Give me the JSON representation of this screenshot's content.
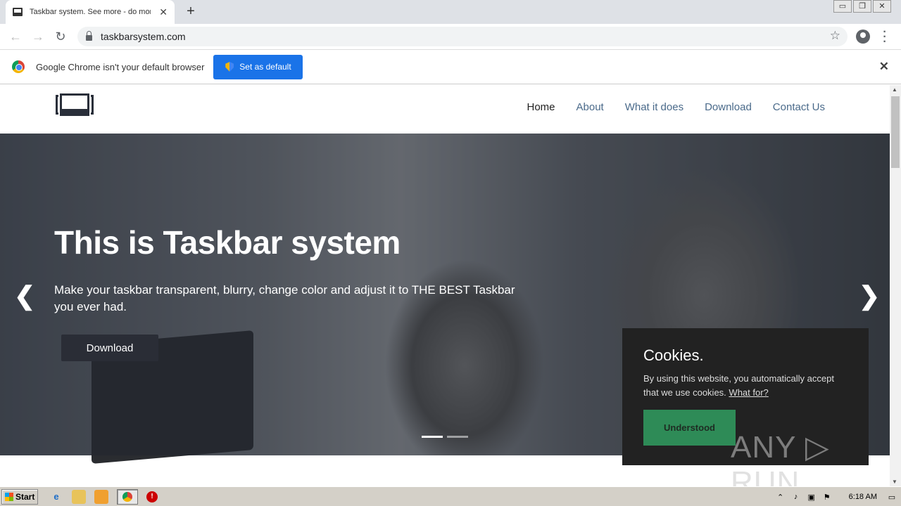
{
  "browser": {
    "tab_title": "Taskbar system. See more - do more",
    "tab_close": "✕",
    "new_tab": "+",
    "url": "taskbarsystem.com",
    "window_buttons": [
      "▭",
      "❐",
      "✕"
    ]
  },
  "infobar": {
    "message": "Google Chrome isn't your default browser",
    "button_label": "Set as default",
    "close": "✕"
  },
  "site": {
    "nav": [
      {
        "label": "Home",
        "active": true
      },
      {
        "label": "About"
      },
      {
        "label": "What it does"
      },
      {
        "label": "Download"
      },
      {
        "label": "Contact Us"
      }
    ],
    "hero": {
      "title": "This is Taskbar system",
      "subtitle": "Make your taskbar transparent, blurry, change color and adjust it to THE BEST Taskbar you ever had.",
      "button_label": "Download",
      "prev": "❮",
      "next": "❯"
    },
    "cookie": {
      "title": "Cookies.",
      "text": "By using this website, you automatically accept that we use cookies.",
      "link": "What for?",
      "button_label": "Understood"
    },
    "watermark": "ANY ▷ RUN"
  },
  "taskbar": {
    "start_label": "Start",
    "clock": "6:18 AM"
  },
  "colors": {
    "primary_button": "#1a73e8",
    "cookie_button": "#2e8b57",
    "cookie_bg": "#222222",
    "hero_button": "#2a2d36"
  }
}
